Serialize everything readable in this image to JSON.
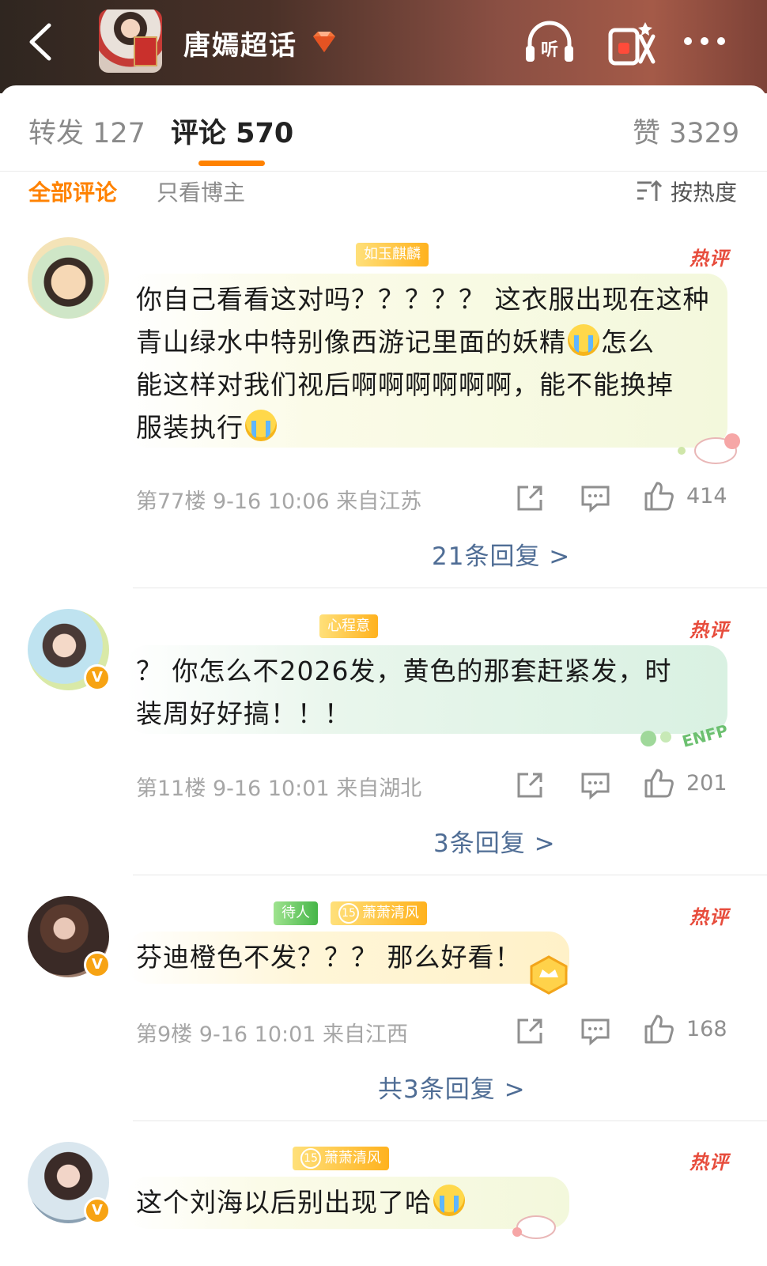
{
  "header": {
    "title": "唐嫣超话",
    "icons": [
      "back-arrow-icon",
      "diamond-icon",
      "listen-icon",
      "red-packet-icon",
      "more-icon"
    ],
    "listen_label": "听"
  },
  "tabs": [
    {
      "label": "转发 127"
    },
    {
      "label": "评论 570",
      "active": true
    },
    {
      "label": "赞 3329"
    }
  ],
  "filters": {
    "all": "全部评论",
    "author_only": "只看博主",
    "sort": "按热度"
  },
  "accent_color": "#ff8200",
  "comments": [
    {
      "fan_badge": "如玉麒麟",
      "hot_tag": "热评",
      "text_lines": [
        "你自己看看这对吗？？？？？ 这衣服出现在这种",
        "青山绿水中特别像西游记里面的妖精",
        "怎么",
        "能这样对我们视后啊啊啊啊啊啊，能不能换掉",
        "服装执行"
      ],
      "floor": "第77楼",
      "time": "9-16 10:06",
      "location": "来自江苏",
      "likes": "414",
      "replies": "21条回复 >"
    },
    {
      "fan_badge": "心程意",
      "hot_tag": "热评",
      "text_lines": [
        "？ 你怎么不2026发，黄色的那套赶紧发，时",
        "装周好好搞！！！"
      ],
      "floor": "第11楼",
      "time": "9-16 10:01",
      "location": "来自湖北",
      "likes": "201",
      "replies": "3条回复 >",
      "sticker": "ENFP"
    },
    {
      "fan_badge_1": "待人",
      "fan_badge_2": "萧萧清风",
      "fan_level": "15",
      "hot_tag": "热评",
      "text": "芬迪橙色不发？？？ 那么好看！",
      "floor": "第9楼",
      "time": "9-16 10:01",
      "location": "来自江西",
      "likes": "168",
      "replies": "共3条回复 >"
    },
    {
      "fan_badge": "萧萧清风",
      "fan_level": "15",
      "hot_tag": "热评",
      "text": "这个刘海以后别出现了哈"
    }
  ]
}
